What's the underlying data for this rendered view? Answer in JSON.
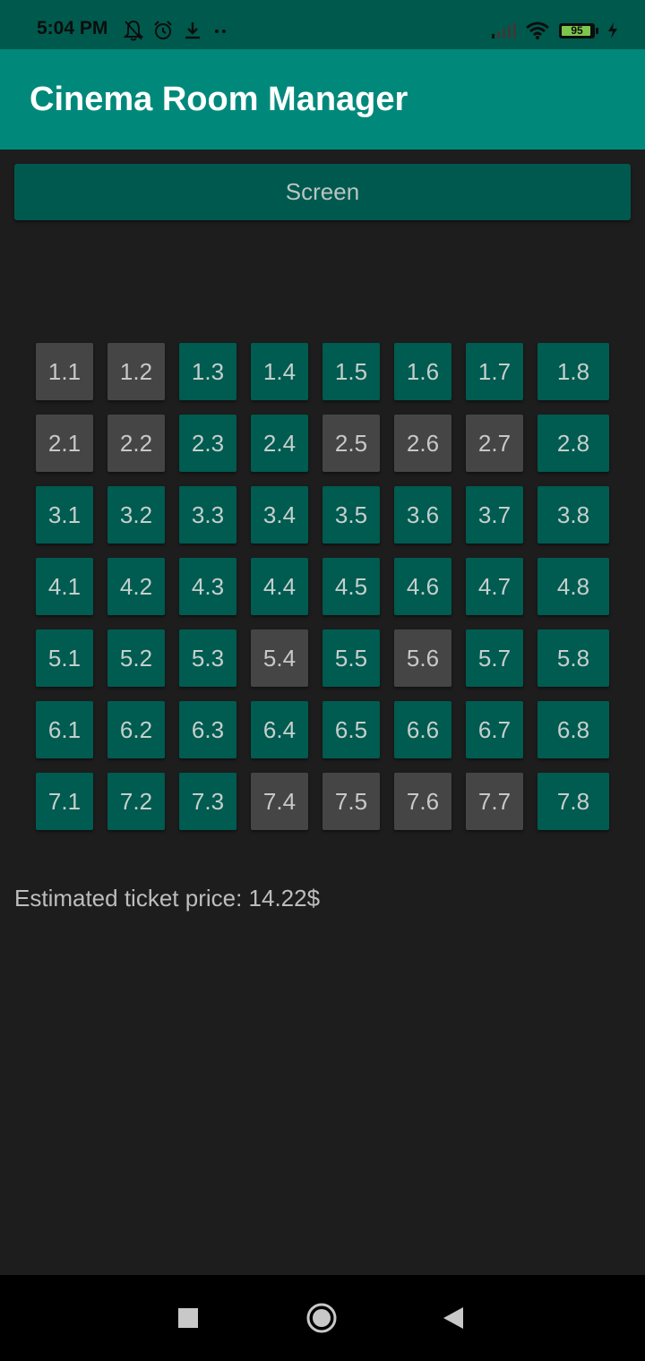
{
  "status_bar": {
    "time": "5:04 PM",
    "left_icons": [
      "bell-off-icon",
      "alarm-icon",
      "download-icon",
      "more-dots-icon"
    ],
    "right_icons": [
      "signal-icon",
      "wifi-icon",
      "battery-icon",
      "charging-icon"
    ],
    "battery_level": "95",
    "battery_fraction": 0.95
  },
  "app_bar": {
    "title": "Cinema Room Manager",
    "color": "#00897b"
  },
  "screen": {
    "label": "Screen"
  },
  "seats": {
    "free_color": "#005b50",
    "taken_color": "#454545",
    "rows": [
      [
        {
          "label": "1.1",
          "taken": true
        },
        {
          "label": "1.2",
          "taken": true
        },
        {
          "label": "1.3",
          "taken": false
        },
        {
          "label": "1.4",
          "taken": false
        },
        {
          "label": "1.5",
          "taken": false
        },
        {
          "label": "1.6",
          "taken": false
        },
        {
          "label": "1.7",
          "taken": false
        },
        {
          "label": "1.8",
          "taken": false
        }
      ],
      [
        {
          "label": "2.1",
          "taken": true
        },
        {
          "label": "2.2",
          "taken": true
        },
        {
          "label": "2.3",
          "taken": false
        },
        {
          "label": "2.4",
          "taken": false
        },
        {
          "label": "2.5",
          "taken": true
        },
        {
          "label": "2.6",
          "taken": true
        },
        {
          "label": "2.7",
          "taken": true
        },
        {
          "label": "2.8",
          "taken": false
        }
      ],
      [
        {
          "label": "3.1",
          "taken": false
        },
        {
          "label": "3.2",
          "taken": false
        },
        {
          "label": "3.3",
          "taken": false
        },
        {
          "label": "3.4",
          "taken": false
        },
        {
          "label": "3.5",
          "taken": false
        },
        {
          "label": "3.6",
          "taken": false
        },
        {
          "label": "3.7",
          "taken": false
        },
        {
          "label": "3.8",
          "taken": false
        }
      ],
      [
        {
          "label": "4.1",
          "taken": false
        },
        {
          "label": "4.2",
          "taken": false
        },
        {
          "label": "4.3",
          "taken": false
        },
        {
          "label": "4.4",
          "taken": false
        },
        {
          "label": "4.5",
          "taken": false
        },
        {
          "label": "4.6",
          "taken": false
        },
        {
          "label": "4.7",
          "taken": false
        },
        {
          "label": "4.8",
          "taken": false
        }
      ],
      [
        {
          "label": "5.1",
          "taken": false
        },
        {
          "label": "5.2",
          "taken": false
        },
        {
          "label": "5.3",
          "taken": false
        },
        {
          "label": "5.4",
          "taken": true
        },
        {
          "label": "5.5",
          "taken": false
        },
        {
          "label": "5.6",
          "taken": true
        },
        {
          "label": "5.7",
          "taken": false
        },
        {
          "label": "5.8",
          "taken": false
        }
      ],
      [
        {
          "label": "6.1",
          "taken": false
        },
        {
          "label": "6.2",
          "taken": false
        },
        {
          "label": "6.3",
          "taken": false
        },
        {
          "label": "6.4",
          "taken": false
        },
        {
          "label": "6.5",
          "taken": false
        },
        {
          "label": "6.6",
          "taken": false
        },
        {
          "label": "6.7",
          "taken": false
        },
        {
          "label": "6.8",
          "taken": false
        }
      ],
      [
        {
          "label": "7.1",
          "taken": false
        },
        {
          "label": "7.2",
          "taken": false
        },
        {
          "label": "7.3",
          "taken": false
        },
        {
          "label": "7.4",
          "taken": true
        },
        {
          "label": "7.5",
          "taken": true
        },
        {
          "label": "7.6",
          "taken": true
        },
        {
          "label": "7.7",
          "taken": true
        },
        {
          "label": "7.8",
          "taken": false
        }
      ]
    ]
  },
  "price": {
    "text": "Estimated ticket price: 14.22$"
  },
  "nav_bar": {
    "icons": [
      "recents-icon",
      "home-icon",
      "back-icon"
    ]
  }
}
